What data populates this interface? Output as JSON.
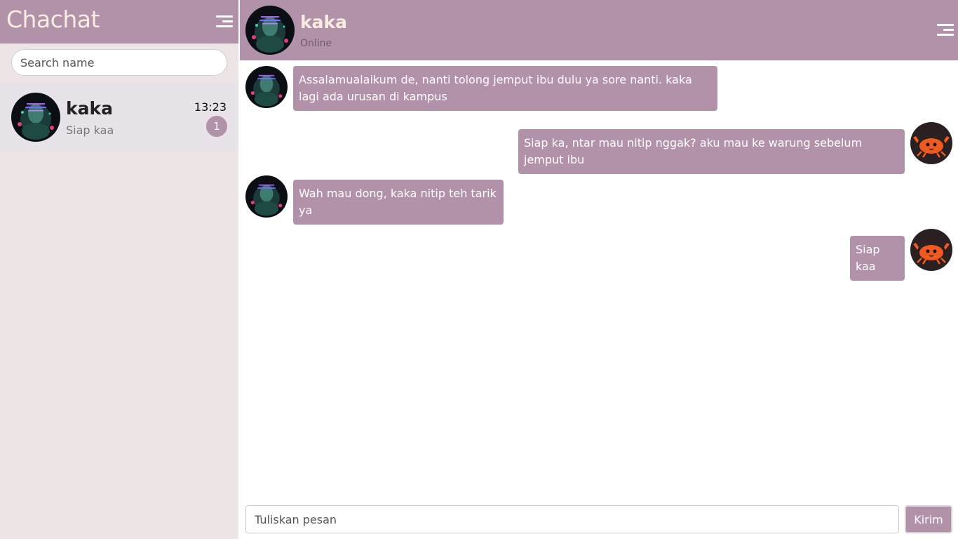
{
  "app": {
    "title": "Chachat"
  },
  "sidebar": {
    "search_placeholder": "Search name",
    "contacts": [
      {
        "name": "kaka",
        "last_message": "Siap kaa",
        "time": "13:23",
        "unread": "1",
        "avatar": "glitch-portrait-avatar"
      }
    ]
  },
  "chat": {
    "contact_name": "kaka",
    "status": "Online",
    "messages": [
      {
        "from": "contact",
        "text": "Assalamualaikum de, nanti tolong jemput ibu dulu ya sore nanti. kaka lagi ada urusan di kampus"
      },
      {
        "from": "me",
        "text": "Siap ka, ntar mau nitip nggak? aku mau ke warung sebelum jemput ibu"
      },
      {
        "from": "contact",
        "text": "Wah mau dong, kaka nitip teh tarik ya"
      },
      {
        "from": "me",
        "text": "Siap kaa"
      }
    ],
    "input_placeholder": "Tuliskan pesan",
    "send_label": "Kirim"
  },
  "colors": {
    "accent": "#b292a9",
    "sidebar_bg": "#ede5e5",
    "title_text": "#fbece2"
  },
  "icons": {
    "menu": "hamburger-menu-icon",
    "self_avatar": "crab-avatar"
  }
}
